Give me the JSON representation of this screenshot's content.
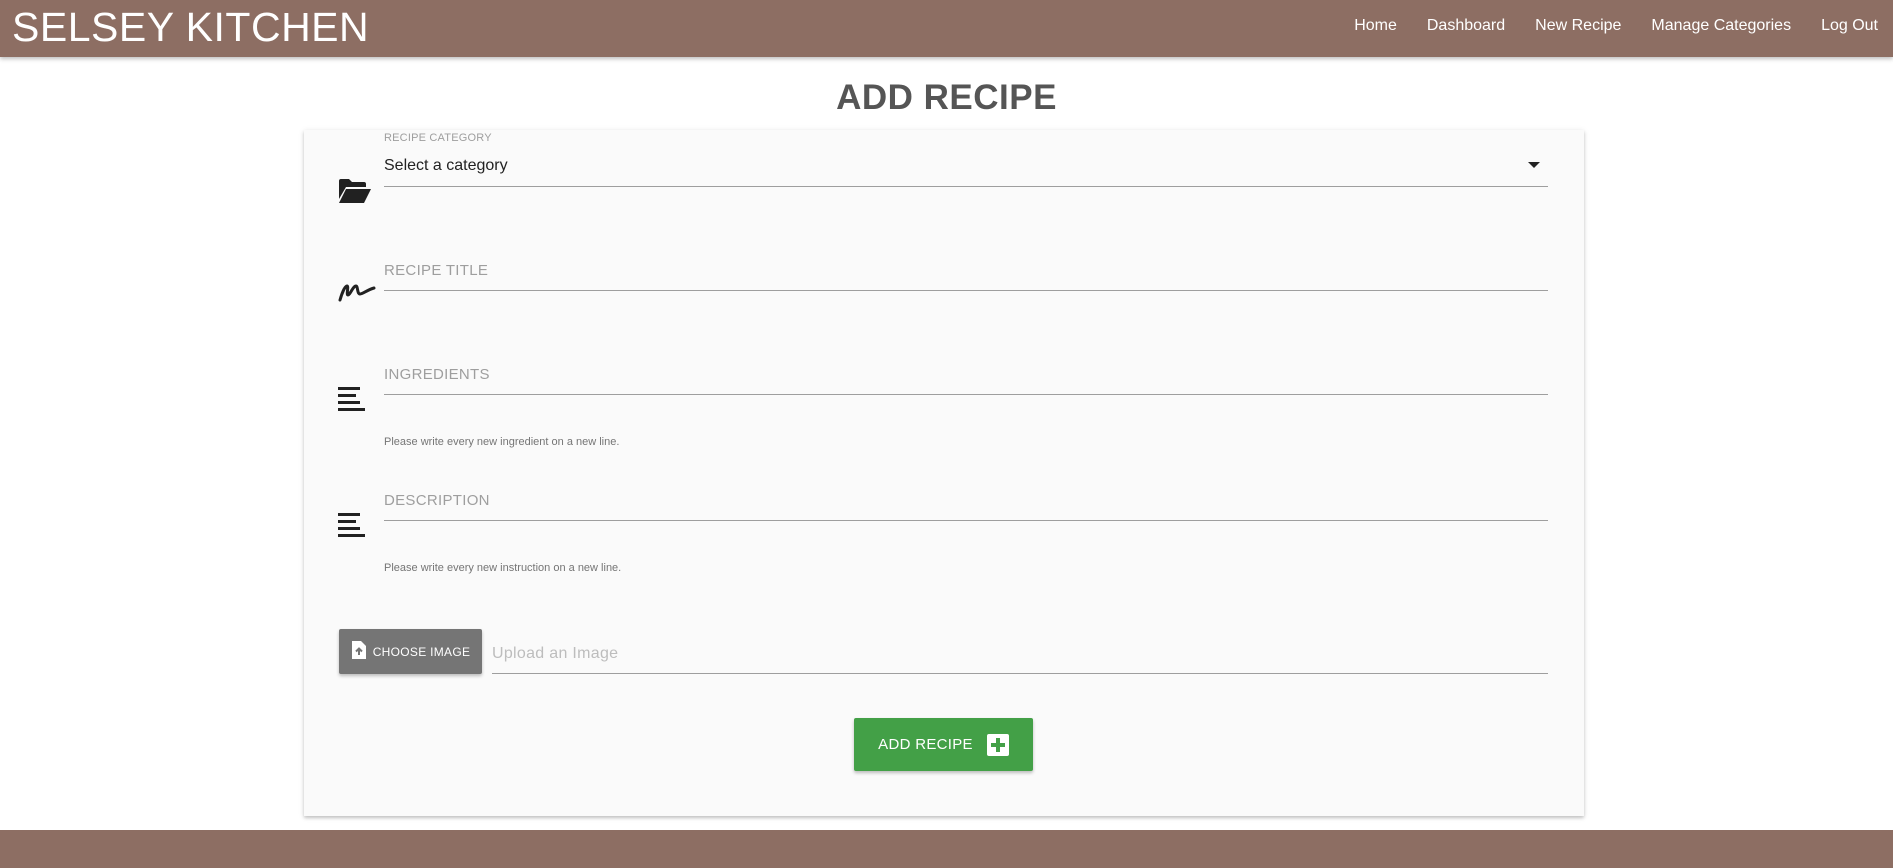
{
  "navbar": {
    "brand": "SELSEY KITCHEN",
    "links": [
      "Home",
      "Dashboard",
      "New Recipe",
      "Manage Categories",
      "Log Out"
    ]
  },
  "page": {
    "title": "ADD RECIPE"
  },
  "form": {
    "category": {
      "label": "RECIPE CATEGORY",
      "value": "Select a category",
      "icon": "folder-open-icon"
    },
    "title": {
      "placeholder": "RECIPE TITLE",
      "icon": "signature-icon"
    },
    "ingredients": {
      "placeholder": "INGREDIENTS",
      "helper": "Please write every new ingredient on a new line.",
      "icon": "align-left-icon"
    },
    "description": {
      "placeholder": "DESCRIPTION",
      "helper": "Please write every new instruction on a new line.",
      "icon": "align-left-icon"
    },
    "image": {
      "button_label": "CHOOSE IMAGE",
      "placeholder": "Upload an Image",
      "icon": "file-upload-icon"
    },
    "submit_label": "ADD RECIPE"
  },
  "colors": {
    "navbar": "#8d6e63",
    "submit": "#43a047",
    "file_button": "#757575",
    "card": "#fafafa"
  }
}
